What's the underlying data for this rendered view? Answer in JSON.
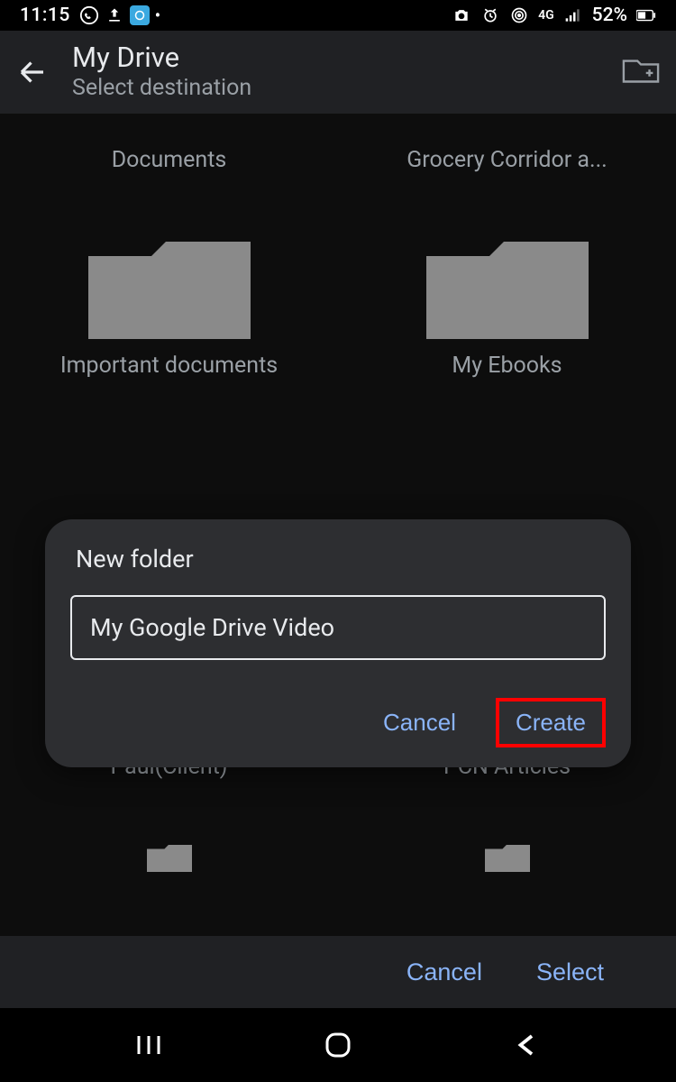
{
  "status": {
    "time": "11:15",
    "network": "4G",
    "battery": "52%"
  },
  "header": {
    "title": "My Drive",
    "subtitle": "Select destination"
  },
  "folders": {
    "row1_left": "Documents",
    "row1_right": "Grocery Corridor a...",
    "row2_left": "Important documents",
    "row2_right": "My Ebooks",
    "row3_left": "Paul(Client)",
    "row3_right": "PCN Articles"
  },
  "dialog": {
    "title": "New folder",
    "input_value": "My Google Drive Video",
    "cancel": "Cancel",
    "create": "Create"
  },
  "bottom": {
    "cancel": "Cancel",
    "select": "Select"
  }
}
